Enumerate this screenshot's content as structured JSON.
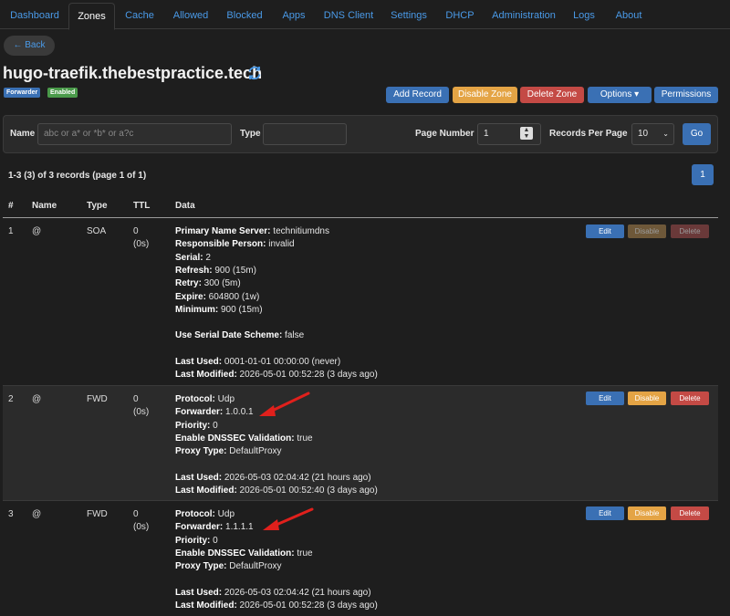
{
  "nav": {
    "tabs": [
      {
        "label": "Dashboard"
      },
      {
        "label": "Zones"
      },
      {
        "label": "Cache"
      },
      {
        "label": "Allowed"
      },
      {
        "label": "Blocked"
      },
      {
        "label": "Apps"
      },
      {
        "label": "DNS Client"
      },
      {
        "label": "Settings"
      },
      {
        "label": "DHCP"
      },
      {
        "label": "Administration"
      },
      {
        "label": "Logs"
      },
      {
        "label": "About"
      }
    ],
    "active": "Zones"
  },
  "back_label": "← Back",
  "zone": {
    "name": "hugo-traefik.thebestpractice.tech",
    "type_badge": "Forwarder",
    "status_badge": "Enabled"
  },
  "actions": {
    "add_record": "Add Record",
    "disable_zone": "Disable Zone",
    "delete_zone": "Delete Zone",
    "options": "Options ▾",
    "permissions": "Permissions"
  },
  "filter": {
    "name_label": "Name",
    "name_placeholder": "abc or a* or *b* or a?c",
    "type_label": "Type",
    "page_number_label": "Page Number",
    "page_number_value": "1",
    "records_per_page_label": "Records Per Page",
    "records_per_page_value": "10",
    "go_label": "Go"
  },
  "summary": "1-3 (3) of 3 records (page 1 of 1)",
  "pagination": {
    "current": "1"
  },
  "table": {
    "headers": {
      "num": "#",
      "name": "Name",
      "type": "Type",
      "ttl": "TTL",
      "data": "Data"
    },
    "buttons": {
      "edit": "Edit",
      "disable": "Disable",
      "delete": "Delete"
    },
    "rows": [
      {
        "num": "1",
        "name": "@",
        "type": "SOA",
        "ttl": "0",
        "ttl_sub": "(0s)",
        "lines": [
          {
            "k": "Primary Name Server:",
            "v": " technitiumdns"
          },
          {
            "k": "Responsible Person:",
            "v": " invalid"
          },
          {
            "k": "Serial:",
            "v": " 2"
          },
          {
            "k": "Refresh:",
            "v": " 900 (15m)"
          },
          {
            "k": "Retry:",
            "v": " 300 (5m)"
          },
          {
            "k": "Expire:",
            "v": " 604800 (1w)"
          },
          {
            "k": "Minimum:",
            "v": " 900 (15m)"
          },
          {
            "k": "",
            "v": ""
          },
          {
            "k": "Use Serial Date Scheme:",
            "v": " false"
          },
          {
            "k": "",
            "v": ""
          },
          {
            "k": "Last Used:",
            "v": " 0001-01-01 00:00:00 (never)"
          },
          {
            "k": "Last Modified:",
            "v": " 2026-05-01 00:52:28 (3 days ago)"
          }
        ]
      },
      {
        "num": "2",
        "name": "@",
        "type": "FWD",
        "ttl": "0",
        "ttl_sub": "(0s)",
        "lines": [
          {
            "k": "Protocol:",
            "v": " Udp"
          },
          {
            "k": "Forwarder:",
            "v": " 1.0.0.1"
          },
          {
            "k": "Priority:",
            "v": " 0"
          },
          {
            "k": "Enable DNSSEC Validation:",
            "v": " true"
          },
          {
            "k": "Proxy Type:",
            "v": " DefaultProxy"
          },
          {
            "k": "",
            "v": ""
          },
          {
            "k": "Last Used:",
            "v": " 2026-05-03 02:04:42 (21 hours ago)"
          },
          {
            "k": "Last Modified:",
            "v": " 2026-05-01 00:52:40 (3 days ago)"
          }
        ]
      },
      {
        "num": "3",
        "name": "@",
        "type": "FWD",
        "ttl": "0",
        "ttl_sub": "(0s)",
        "lines": [
          {
            "k": "Protocol:",
            "v": " Udp"
          },
          {
            "k": "Forwarder:",
            "v": " 1.1.1.1"
          },
          {
            "k": "Priority:",
            "v": " 0"
          },
          {
            "k": "Enable DNSSEC Validation:",
            "v": " true"
          },
          {
            "k": "Proxy Type:",
            "v": " DefaultProxy"
          },
          {
            "k": "",
            "v": ""
          },
          {
            "k": "Last Used:",
            "v": " 2026-05-03 02:04:42 (21 hours ago)"
          },
          {
            "k": "Last Modified:",
            "v": " 2026-05-01 00:52:28 (3 days ago)"
          }
        ]
      }
    ]
  },
  "colors": {
    "accent": "#4a9ae8",
    "primary": "#3a70b4",
    "warning": "#e4a445",
    "danger": "#c44a45",
    "annotation": "#e0201c"
  },
  "icons": {
    "refresh": "refresh-icon",
    "arrow": "red-arrow-annotation"
  }
}
